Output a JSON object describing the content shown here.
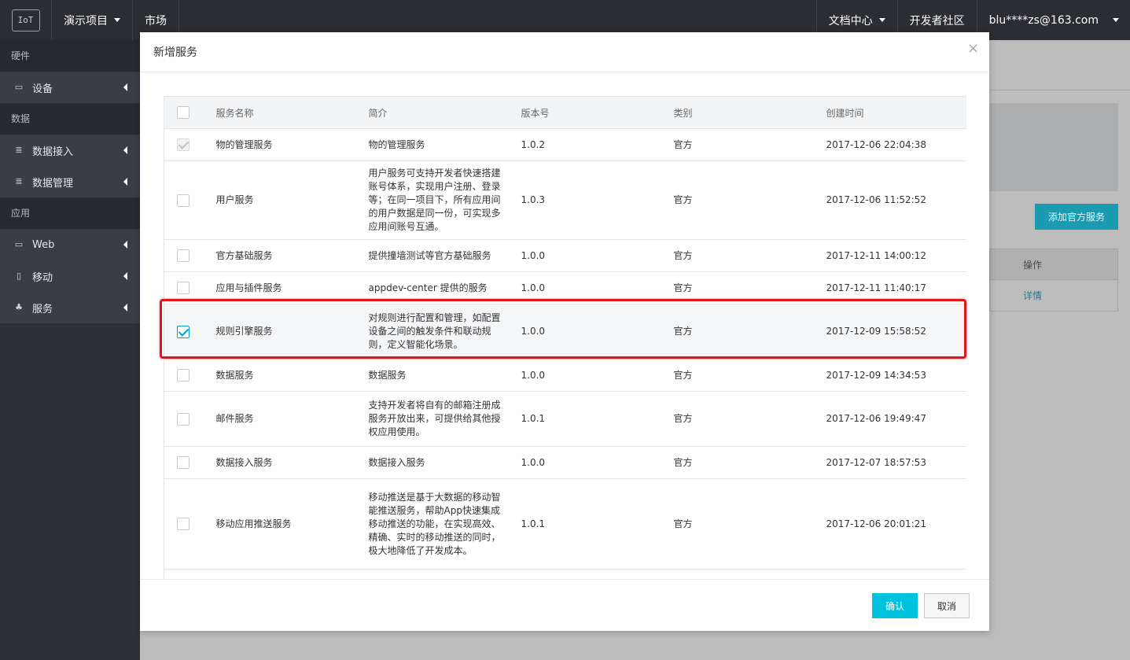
{
  "topbar": {
    "logo_text": "IoT",
    "project": "演示项目",
    "market": "市场",
    "docs": "文档中心",
    "community": "开发者社区",
    "user": "blu****zs@163.com"
  },
  "sidebar": {
    "sections": [
      {
        "label": "硬件",
        "items": [
          {
            "label": "设备",
            "icon": "device-icon"
          }
        ]
      },
      {
        "label": "数据",
        "items": [
          {
            "label": "数据接入",
            "icon": "data-access-icon"
          },
          {
            "label": "数据管理",
            "icon": "data-manage-icon"
          }
        ]
      },
      {
        "label": "应用",
        "items": [
          {
            "label": "Web",
            "icon": "monitor-icon"
          },
          {
            "label": "移动",
            "icon": "mobile-icon"
          },
          {
            "label": "服务",
            "icon": "service-icon"
          }
        ]
      }
    ]
  },
  "background": {
    "add_button": "添加官方服务",
    "col_action": "操作",
    "row_action": "详情"
  },
  "modal": {
    "title": "新增服务",
    "columns": [
      "服务名称",
      "简介",
      "版本号",
      "类别",
      "创建时间"
    ],
    "rows": [
      {
        "name": "物的管理服务",
        "desc": "物的管理服务",
        "version": "1.0.2",
        "type": "官方",
        "time": "2017-12-06 22:04:38",
        "state": "disabled"
      },
      {
        "name": "用户服务",
        "desc": "用户服务可支持开发者快速搭建账号体系，实现用户注册、登录等；在同一项目下，所有应用间的用户数据是同一份，可实现多应用间账号互通。",
        "version": "1.0.3",
        "type": "官方",
        "time": "2017-12-06 11:52:52",
        "state": "unchecked"
      },
      {
        "name": "官方基础服务",
        "desc": "提供撞墙测试等官方基础服务",
        "version": "1.0.0",
        "type": "官方",
        "time": "2017-12-11 14:00:12",
        "state": "unchecked"
      },
      {
        "name": "应用与插件服务",
        "desc": "appdev-center 提供的服务",
        "version": "1.0.0",
        "type": "官方",
        "time": "2017-12-11 11:40:17",
        "state": "unchecked"
      },
      {
        "name": "规则引擎服务",
        "desc": "对规则进行配置和管理，如配置设备之间的触发条件和联动规则，定义智能化场景。",
        "version": "1.0.0",
        "type": "官方",
        "time": "2017-12-09 15:58:52",
        "state": "checked"
      },
      {
        "name": "数据服务",
        "desc": "数据服务",
        "version": "1.0.0",
        "type": "官方",
        "time": "2017-12-09 14:34:53",
        "state": "unchecked"
      },
      {
        "name": "邮件服务",
        "desc": "支持开发者将自有的邮箱注册成服务开放出来，可提供给其他授权应用使用。",
        "version": "1.0.1",
        "type": "官方",
        "time": "2017-12-06 19:49:47",
        "state": "unchecked"
      },
      {
        "name": "数据接入服务",
        "desc": "数据接入服务",
        "version": "1.0.0",
        "type": "官方",
        "time": "2017-12-07 18:57:53",
        "state": "unchecked"
      },
      {
        "name": "移动应用推送服务",
        "desc": "移动推送是基于大数据的移动智能推送服务，帮助App快速集成移动推送的功能，在实现高效、精确、实时的移动推送的同时，极大地降低了开发成本。",
        "version": "1.0.1",
        "type": "官方",
        "time": "2017-12-06 20:01:21",
        "state": "unchecked"
      }
    ],
    "confirm": "确认",
    "cancel": "取消"
  },
  "colors": {
    "accent": "#00c1de",
    "highlight": "#e0151a",
    "topbar": "#2b2d33",
    "sidebar": "#2e3037"
  }
}
